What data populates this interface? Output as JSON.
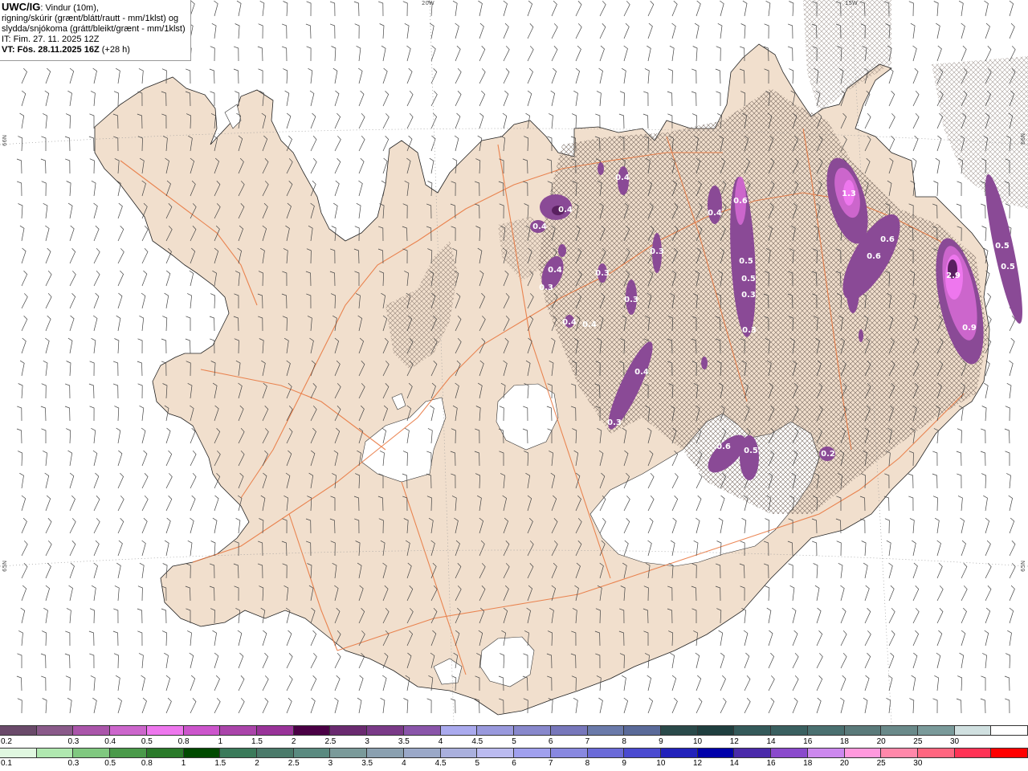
{
  "title": {
    "code": "UWC/IG",
    "line1_rest": ": Vindur (10m),",
    "line2": "rigning/skúrir (grænt/blátt/rautt - mm/1klst) og",
    "line3": "slydda/snjókoma (grátt/bleikt/grænt - mm/1klst)",
    "line4": "IT: Fim. 27. 11. 2025 12Z",
    "vt": "VT: Fös. 28.11.2025 16Z",
    "vt_rest": " (+28 h)"
  },
  "grid_labels": {
    "lon_20w": "20W",
    "lon_15w": "15W",
    "lat_66n_left": "66N",
    "lat_66n_right": "66N",
    "lat_65n_left": "65N",
    "lat_65n_right": "65N"
  },
  "colors": {
    "land": "#f1dfcd",
    "sea": "#ffffff",
    "roads": "#e8733a",
    "coastline": "#222222",
    "snow_hatch": "#7a6a60",
    "precip_light": "#c58ed6",
    "precip_mid": "#8a4a96",
    "precip_dark": "#5a2060",
    "precip_bright": "#ee66ee"
  },
  "precip_labels": [
    {
      "id": "p1",
      "text": "0.4"
    },
    {
      "id": "p2",
      "text": "0.4"
    },
    {
      "id": "p3",
      "text": "0.4"
    },
    {
      "id": "p4",
      "text": "0.3"
    },
    {
      "id": "p5",
      "text": "0.3"
    },
    {
      "id": "p6",
      "text": "0.3"
    },
    {
      "id": "p7",
      "text": "0.4"
    },
    {
      "id": "p8",
      "text": "0.3"
    },
    {
      "id": "p9",
      "text": "0.4"
    },
    {
      "id": "p10",
      "text": "0.6"
    },
    {
      "id": "p11",
      "text": "0.4"
    },
    {
      "id": "p12",
      "text": "0.5"
    },
    {
      "id": "p13",
      "text": "0.5"
    },
    {
      "id": "p14",
      "text": "0.3"
    },
    {
      "id": "p15",
      "text": "1.3"
    },
    {
      "id": "p16",
      "text": "0.6"
    },
    {
      "id": "p17",
      "text": "0.6"
    },
    {
      "id": "p18",
      "text": "2.9"
    },
    {
      "id": "p19",
      "text": "0.9"
    },
    {
      "id": "p20",
      "text": "0.5"
    },
    {
      "id": "p21",
      "text": "0.5"
    },
    {
      "id": "p22",
      "text": "0.4"
    },
    {
      "id": "p23",
      "text": "0.3"
    },
    {
      "id": "p24",
      "text": "0.6"
    },
    {
      "id": "p25",
      "text": "0.5"
    },
    {
      "id": "p26",
      "text": "0.2"
    },
    {
      "id": "p27",
      "text": "0.4"
    },
    {
      "id": "p28",
      "text": "0.3"
    }
  ],
  "legend_snow": {
    "colors": [
      "#6a4a6a",
      "#8a5a8a",
      "#aa55aa",
      "#cc66cc",
      "#ee77ee",
      "#cc55cc",
      "#aa44aa",
      "#993399",
      "#4a0045",
      "#6a2a70",
      "#7a3a88",
      "#8a55aa",
      "#aaaaee",
      "#9999dd",
      "#8888cc",
      "#7777bb",
      "#6a7aaa",
      "#5a6a99",
      "#2a4a4a",
      "#1f3f3f",
      "#345a5a",
      "#3a6060",
      "#4a7070",
      "#5a7a7a",
      "#6a8a8a",
      "#7a9a9a",
      "#d0e0e0",
      "#ffffff"
    ],
    "ticks": [
      "0.2",
      "0.3",
      "0.4",
      "0.5",
      "0.8",
      "1",
      "1.5",
      "2",
      "2.5",
      "3",
      "3.5",
      "4",
      "4.5",
      "5",
      "6",
      "7",
      "8",
      "9",
      "10",
      "12",
      "14",
      "16",
      "18",
      "20",
      "25",
      "30"
    ]
  },
  "legend_rain": {
    "colors": [
      "#e0f7e0",
      "#b0e8b0",
      "#80c880",
      "#4a9a4a",
      "#2a7a2a",
      "#004a00",
      "#3a7a5a",
      "#4a7a6a",
      "#5a8a80",
      "#7a9a9a",
      "#8aa0b0",
      "#9aa8c8",
      "#aab0dd",
      "#bbbbf0",
      "#a0a0ee",
      "#8888e0",
      "#6a6ad8",
      "#4a4ad0",
      "#2222bb",
      "#0000aa",
      "#4a2aaa",
      "#8a4acc",
      "#cc88ee",
      "#ff99dd",
      "#ff88aa",
      "#ff6680",
      "#ff3355",
      "#ff0000"
    ],
    "ticks": [
      "0.1",
      "0.3",
      "0.5",
      "0.8",
      "1",
      "1.5",
      "2",
      "2.5",
      "3",
      "3.5",
      "4",
      "4.5",
      "5",
      "6",
      "7",
      "8",
      "9",
      "10",
      "12",
      "14",
      "16",
      "18",
      "20",
      "25",
      "30"
    ]
  }
}
